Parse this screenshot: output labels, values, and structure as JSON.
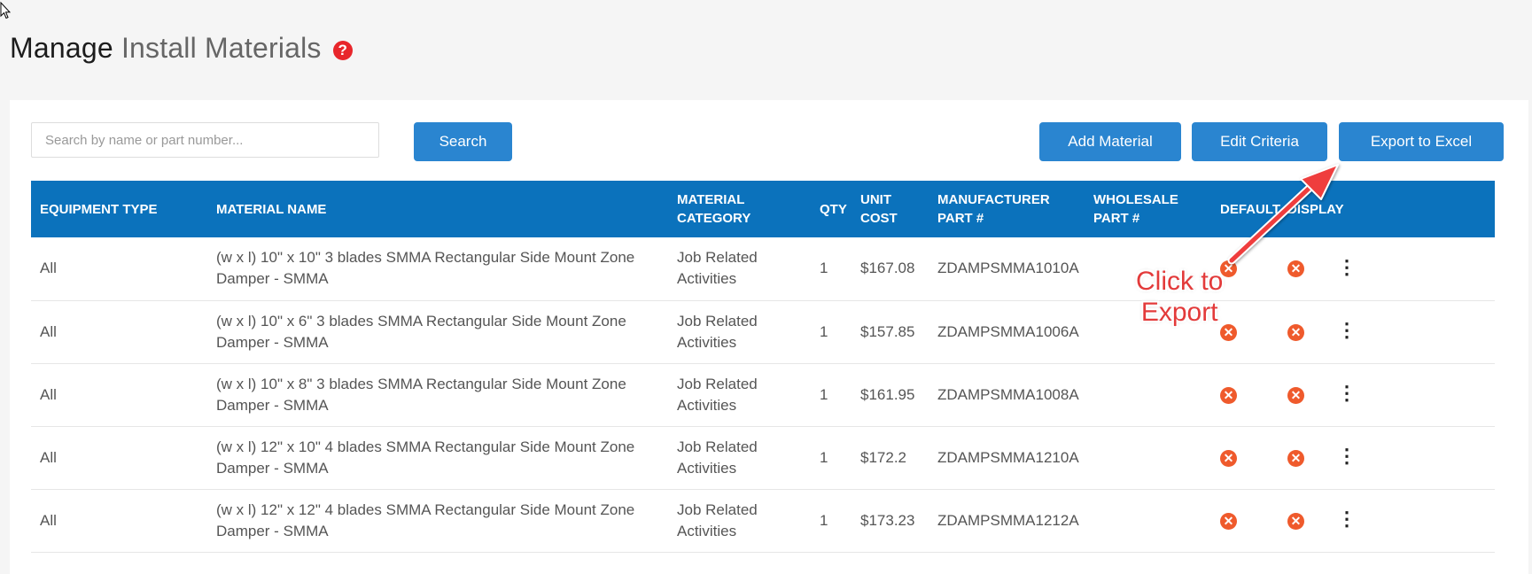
{
  "page": {
    "title_bold": "Manage",
    "title_light": "Install Materials",
    "help_icon": "?"
  },
  "toolbar": {
    "search_placeholder": "Search by name or part number...",
    "search_value": "",
    "search_label": "Search",
    "add_label": "Add Material",
    "edit_label": "Edit Criteria",
    "export_label": "Export to Excel"
  },
  "table": {
    "columns": [
      "EQUIPMENT TYPE",
      "MATERIAL NAME",
      "MATERIAL CATEGORY",
      "QTY",
      "UNIT COST",
      "MANUFACTURER PART #",
      "WHOLESALE PART #",
      "DEFAULT",
      "DISPLAY"
    ],
    "rows": [
      {
        "equipment": "All",
        "name": "(w x l) 10\" x 10\" 3 blades SMMA Rectangular Side Mount Zone Damper - SMMA",
        "category": "Job Related Activities",
        "qty": "1",
        "cost": "$167.08",
        "mfr_part": "ZDAMPSMMA1010A",
        "wholesale_part": "",
        "default": "✕",
        "display": "✕"
      },
      {
        "equipment": "All",
        "name": "(w x l) 10\" x 6\" 3 blades SMMA Rectangular Side Mount Zone Damper - SMMA",
        "category": "Job Related Activities",
        "qty": "1",
        "cost": "$157.85",
        "mfr_part": "ZDAMPSMMA1006A",
        "wholesale_part": "",
        "default": "✕",
        "display": "✕"
      },
      {
        "equipment": "All",
        "name": "(w x l) 10\" x 8\" 3 blades SMMA Rectangular Side Mount Zone Damper - SMMA",
        "category": "Job Related Activities",
        "qty": "1",
        "cost": "$161.95",
        "mfr_part": "ZDAMPSMMA1008A",
        "wholesale_part": "",
        "default": "✕",
        "display": "✕"
      },
      {
        "equipment": "All",
        "name": "(w x l) 12\" x 10\" 4 blades SMMA Rectangular Side Mount Zone Damper - SMMA",
        "category": "Job Related Activities",
        "qty": "1",
        "cost": "$172.2",
        "mfr_part": "ZDAMPSMMA1210A",
        "wholesale_part": "",
        "default": "✕",
        "display": "✕"
      },
      {
        "equipment": "All",
        "name": "(w x l) 12\" x 12\" 4 blades SMMA Rectangular Side Mount Zone Damper - SMMA",
        "category": "Job Related Activities",
        "qty": "1",
        "cost": "$173.23",
        "mfr_part": "ZDAMPSMMA1212A",
        "wholesale_part": "",
        "default": "✕",
        "display": "✕"
      }
    ],
    "row_menu_icon": "⋮"
  },
  "annotation": {
    "line1": "Click to",
    "line2": "Export"
  },
  "colors": {
    "accent": "#2a85d0",
    "header": "#0b72bc",
    "status_x": "#ef5a2c",
    "help": "#e8262b",
    "annotation": "#e33a3a"
  }
}
